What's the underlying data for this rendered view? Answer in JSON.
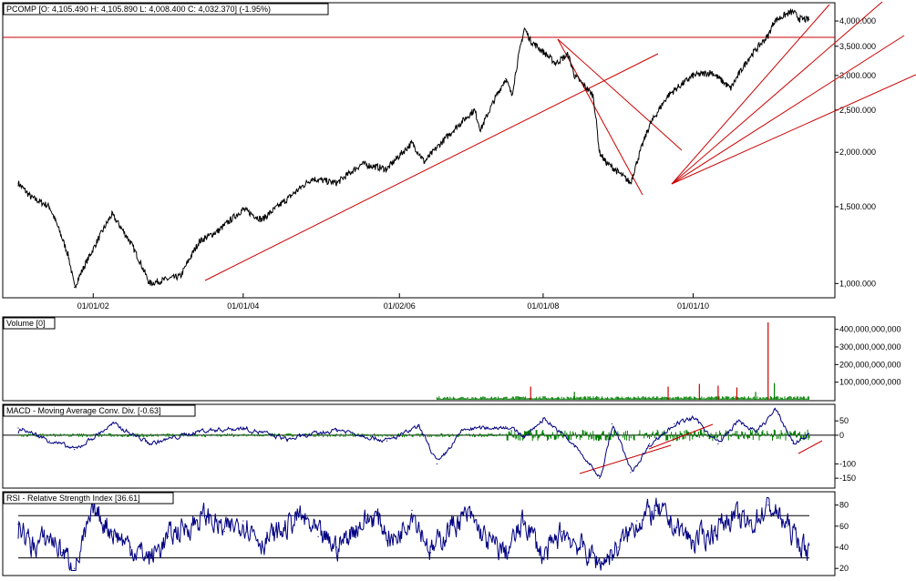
{
  "chart_data": [
    {
      "type": "line",
      "title": "PCOMP [O: 4,105.490  H: 4,105.890  L: 4,008.400  C: 4,032.370] (-1.95%)",
      "scale": "log",
      "ylim": [
        950,
        4300
      ],
      "x_tick_labels": [
        "01/01/02",
        "01/01/04",
        "01/02/06",
        "01/01/08",
        "01/01/10"
      ],
      "y_tick_labels": [
        "1,000.000",
        "1,500.000",
        "2,000.000",
        "2,500.000",
        "3,000.000",
        "3,500.000",
        "4,000.000"
      ],
      "y_ticks": [
        1000,
        1500,
        2000,
        2500,
        3000,
        3500,
        4000
      ],
      "grid": false,
      "x": [
        "2001-01",
        "2001-03",
        "2001-06",
        "2001-09",
        "2001-10",
        "2002-01",
        "2002-04",
        "2002-07",
        "2002-10",
        "2003-03",
        "2003-06",
        "2003-09",
        "2004-01",
        "2004-04",
        "2004-08",
        "2004-12",
        "2005-04",
        "2005-08",
        "2005-12",
        "2006-04",
        "2006-06",
        "2006-08",
        "2006-12",
        "2007-02",
        "2007-03",
        "2007-07",
        "2007-08",
        "2007-10",
        "2007-11",
        "2008-03",
        "2008-05",
        "2008-06",
        "2008-09",
        "2008-10",
        "2008-11",
        "2009-01",
        "2009-03",
        "2009-06",
        "2009-09",
        "2010-01",
        "2010-04",
        "2010-07",
        "2010-10",
        "2011-01",
        "2011-02",
        "2011-04",
        "2011-05",
        "2011-06",
        "2011-07"
      ],
      "values": [
        1700,
        1580,
        1500,
        1160,
        980,
        1200,
        1440,
        1240,
        1000,
        1040,
        1250,
        1320,
        1480,
        1400,
        1560,
        1740,
        1700,
        1880,
        1830,
        2100,
        1900,
        2050,
        2350,
        2500,
        2250,
        2950,
        2700,
        3850,
        3600,
        3200,
        3350,
        3000,
        2700,
        2000,
        1900,
        1800,
        1700,
        2300,
        2700,
        3000,
        3050,
        2800,
        3300,
        3700,
        4000,
        4150,
        4200,
        4050,
        4032
      ]
    },
    {
      "type": "bar",
      "title": "Volume [0]",
      "ylim": [
        0,
        450000000000
      ],
      "y_tick_labels": [
        "100,000,000,000",
        "200,000,000,000",
        "300,000,000,000",
        "400,000,000,000"
      ],
      "y_ticks": [
        100000000000,
        200000000000,
        300000000000,
        400000000000
      ],
      "x": [
        "2007-11",
        "2008-06",
        "2009-09",
        "2010-02",
        "2010-05",
        "2010-08",
        "2010-11",
        "2011-01",
        "2011-02"
      ],
      "values": [
        75000000000,
        45000000000,
        75000000000,
        90000000000,
        80000000000,
        70000000000,
        45000000000,
        440000000000,
        95000000000
      ],
      "colors": {
        "up": "#008000",
        "down": "#cc0000"
      }
    },
    {
      "type": "line",
      "title": "MACD - Moving Average Conv. Div. [-0.63]",
      "ylim": [
        -175,
        95
      ],
      "y_tick_labels": [
        "50",
        "0",
        "-100",
        "-150"
      ],
      "y_ticks": [
        50,
        0,
        -100,
        -150
      ],
      "x": [
        "2001-01",
        "2001-06",
        "2001-10",
        "2002-04",
        "2002-10",
        "2003-06",
        "2004-01",
        "2004-08",
        "2005-04",
        "2005-12",
        "2006-05",
        "2006-08",
        "2006-12",
        "2007-07",
        "2007-10",
        "2008-01",
        "2008-06",
        "2008-10",
        "2008-12",
        "2009-03",
        "2009-06",
        "2009-10",
        "2010-01",
        "2010-05",
        "2010-08",
        "2010-11",
        "2011-02",
        "2011-05",
        "2011-07"
      ],
      "values": [
        25,
        -20,
        -50,
        40,
        -30,
        15,
        25,
        -15,
        20,
        -20,
        30,
        -100,
        20,
        30,
        -5,
        60,
        -40,
        -150,
        40,
        -130,
        -30,
        40,
        60,
        -30,
        50,
        10,
        90,
        -30,
        0
      ],
      "series_color": "#000080",
      "hist_color": "#008000",
      "zero_line": 0
    },
    {
      "type": "line",
      "title": "RSI - Relative Strength Index [36.61]",
      "ylim": [
        15,
        90
      ],
      "y_tick_labels": [
        "80",
        "60",
        "40",
        "20"
      ],
      "y_ticks": [
        80,
        60,
        40,
        20
      ],
      "x": [
        "2001-01",
        "2001-03",
        "2001-06",
        "2001-08",
        "2001-10",
        "2002-01",
        "2002-04",
        "2002-07",
        "2002-10",
        "2003-01",
        "2003-04",
        "2003-07",
        "2003-10",
        "2004-01",
        "2004-04",
        "2004-07",
        "2004-10",
        "2005-01",
        "2005-04",
        "2005-07",
        "2005-10",
        "2006-01",
        "2006-04",
        "2006-07",
        "2006-10",
        "2007-01",
        "2007-04",
        "2007-07",
        "2007-10",
        "2008-01",
        "2008-04",
        "2008-07",
        "2008-10",
        "2009-01",
        "2009-04",
        "2009-07",
        "2009-10",
        "2010-01",
        "2010-04",
        "2010-07",
        "2010-10",
        "2011-01",
        "2011-04",
        "2011-07"
      ],
      "values": [
        62,
        40,
        50,
        35,
        20,
        75,
        55,
        40,
        30,
        50,
        60,
        70,
        55,
        65,
        45,
        55,
        70,
        50,
        40,
        60,
        70,
        45,
        75,
        35,
        60,
        70,
        45,
        35,
        65,
        30,
        55,
        40,
        25,
        40,
        65,
        75,
        60,
        45,
        55,
        70,
        60,
        80,
        60,
        36
      ],
      "levels": [
        70,
        30
      ],
      "series_color": "#000080"
    }
  ],
  "annotations": {
    "horizontal_line_value": 3850,
    "line_color": "#cc0000"
  }
}
